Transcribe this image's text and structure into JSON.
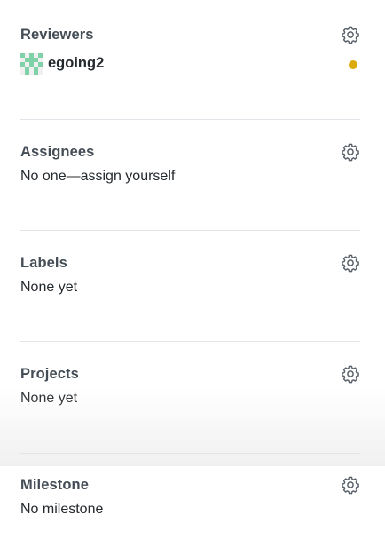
{
  "reviewers": {
    "heading": "Reviewers",
    "gear_icon": "gear-icon",
    "items": [
      {
        "name": "egoing2",
        "avatar_icon": "identicon-avatar",
        "status": "pending",
        "status_color": "#dbab09"
      }
    ]
  },
  "assignees": {
    "heading": "Assignees",
    "gear_icon": "gear-icon",
    "value": "No one—assign yourself"
  },
  "labels": {
    "heading": "Labels",
    "gear_icon": "gear-icon",
    "value": "None yet"
  },
  "projects": {
    "heading": "Projects",
    "gear_icon": "gear-icon",
    "value": "None yet"
  },
  "milestone": {
    "heading": "Milestone",
    "gear_icon": "gear-icon",
    "value": "No milestone"
  },
  "colors": {
    "heading": "#444d56",
    "text": "#24292e",
    "divider": "#e1e4e8",
    "identicon": "#7fd1a8"
  }
}
